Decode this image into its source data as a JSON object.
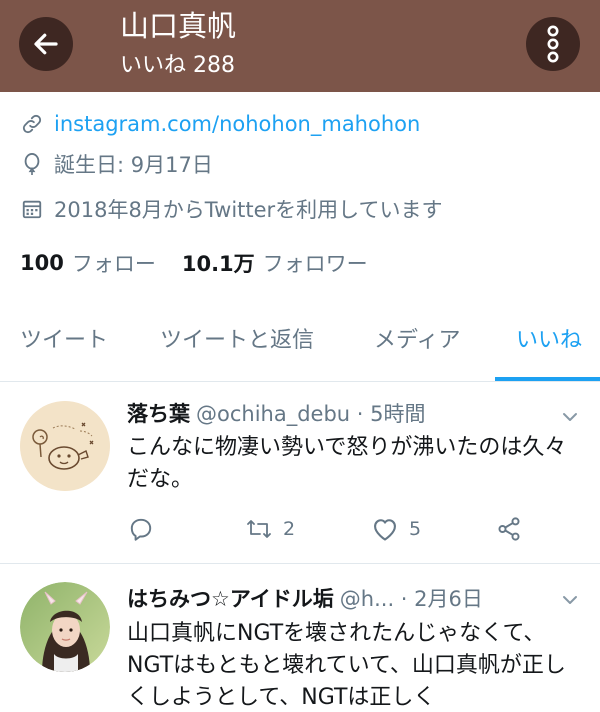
{
  "header": {
    "name": "山口真帆",
    "likes_label": "いいね 288",
    "back_icon": "arrow-left-icon",
    "more_icon": "more-vertical-icon"
  },
  "profile": {
    "link": "instagram.com/nohohon_mahohon",
    "birthday": "誕生日: 9月17日",
    "joined": "2018年8月からTwitterを利用しています",
    "following_count": "100",
    "following_label": "フォロー",
    "followers_count": "10.1万",
    "followers_label": "フォロワー"
  },
  "tabs": [
    {
      "label": "ツイート"
    },
    {
      "label": "ツイートと返信"
    },
    {
      "label": "メディア"
    },
    {
      "label": "いいね",
      "active": true
    }
  ],
  "tweets": [
    {
      "name": "落ち葉",
      "meta": "@ochiha_debu · 5時間",
      "text": "こんなに物凄い勢いで怒りが沸いたのは久々だな。",
      "retweets": "2",
      "likes": "5"
    },
    {
      "name": "はちみつ☆アイドル垢",
      "meta": "@h... · 2月6日",
      "text": "山口真帆にNGTを壊されたんじゃなくて、NGTはもともと壊れていて、山口真帆が正しくしようとして、NGTは正しく"
    }
  ],
  "colors": {
    "header_bg": "#7c5549",
    "button_bg": "#3e2722",
    "accent": "#1da1f2",
    "muted": "#657786"
  }
}
